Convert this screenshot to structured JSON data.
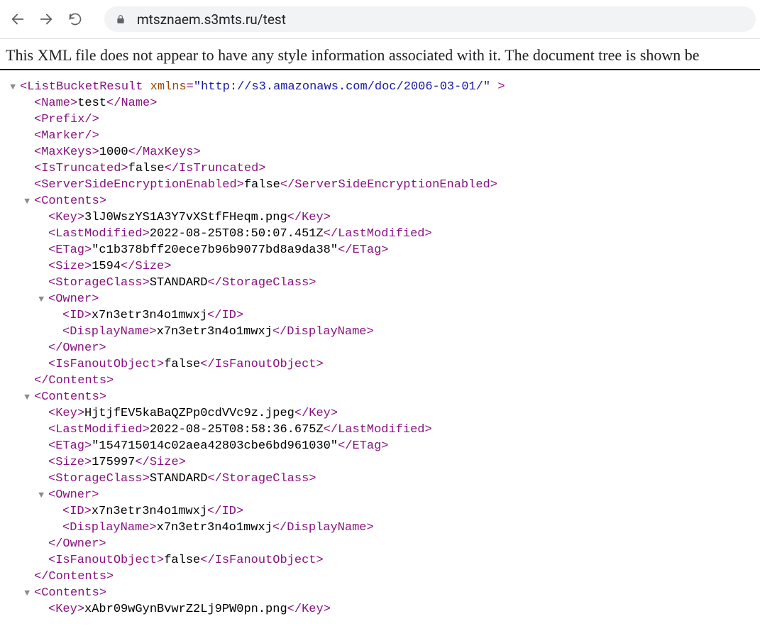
{
  "address_bar": "mtsznaem.s3mts.ru/test",
  "notice": "This XML file does not appear to have any style information associated with it. The document tree is shown be",
  "xml": {
    "root_tag": "ListBucketResult",
    "xmlns_name": "xmlns",
    "xmlns_value": "\"http://s3.amazonaws.com/doc/2006-03-01/\"",
    "name_tag": "Name",
    "name_val": "test",
    "prefix_tag": "Prefix",
    "marker_tag": "Marker",
    "maxkeys_tag": "MaxKeys",
    "maxkeys_val": "1000",
    "istrunc_tag": "IsTruncated",
    "istrunc_val": "false",
    "sse_tag": "ServerSideEncryptionEnabled",
    "sse_val": "false",
    "contents_tag": "Contents",
    "key_tag": "Key",
    "lastmod_tag": "LastModified",
    "etag_tag": "ETag",
    "size_tag": "Size",
    "sclass_tag": "StorageClass",
    "owner_tag": "Owner",
    "id_tag": "ID",
    "dname_tag": "DisplayName",
    "fanout_tag": "IsFanoutObject",
    "items": [
      {
        "key": "3lJ0WszYS1A3Y7vXStfFHeqm.png",
        "lastmod": "2022-08-25T08:50:07.451Z",
        "etag": "\"c1b378bff20ece7b96b9077bd8a9da38\"",
        "size": "1594",
        "sclass": "STANDARD",
        "owner_id": "x7n3etr3n4o1mwxj",
        "owner_dname": "x7n3etr3n4o1mwxj",
        "fanout": "false"
      },
      {
        "key": "HjtjfEV5kaBaQZPp0cdVVc9z.jpeg",
        "lastmod": "2022-08-25T08:58:36.675Z",
        "etag": "\"154715014c02aea42803cbe6bd961030\"",
        "size": "175997",
        "sclass": "STANDARD",
        "owner_id": "x7n3etr3n4o1mwxj",
        "owner_dname": "x7n3etr3n4o1mwxj",
        "fanout": "false"
      },
      {
        "key": "xAbr09wGynBvwrZ2Lj9PW0pn.png"
      }
    ]
  }
}
